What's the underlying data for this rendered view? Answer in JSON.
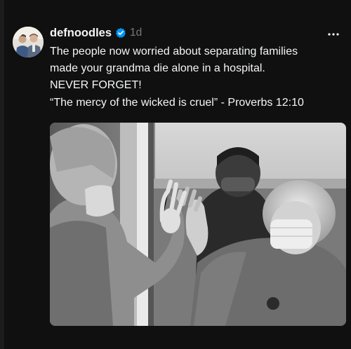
{
  "post": {
    "username": "defnoodles",
    "time": "1d",
    "text_lines": [
      "The people now worried about separating families",
      "made your grandma die alone in a hospital.",
      "NEVER FORGET!",
      "“The mercy of the wicked is cruel” - Proverbs 12:10"
    ]
  },
  "icons": {
    "verified": "verified-badge-icon",
    "more": "more-horizontal-icon"
  },
  "colors": {
    "background": "#101010",
    "text": "#f3f5f7",
    "muted": "#777777",
    "verified": "#0095f6"
  }
}
